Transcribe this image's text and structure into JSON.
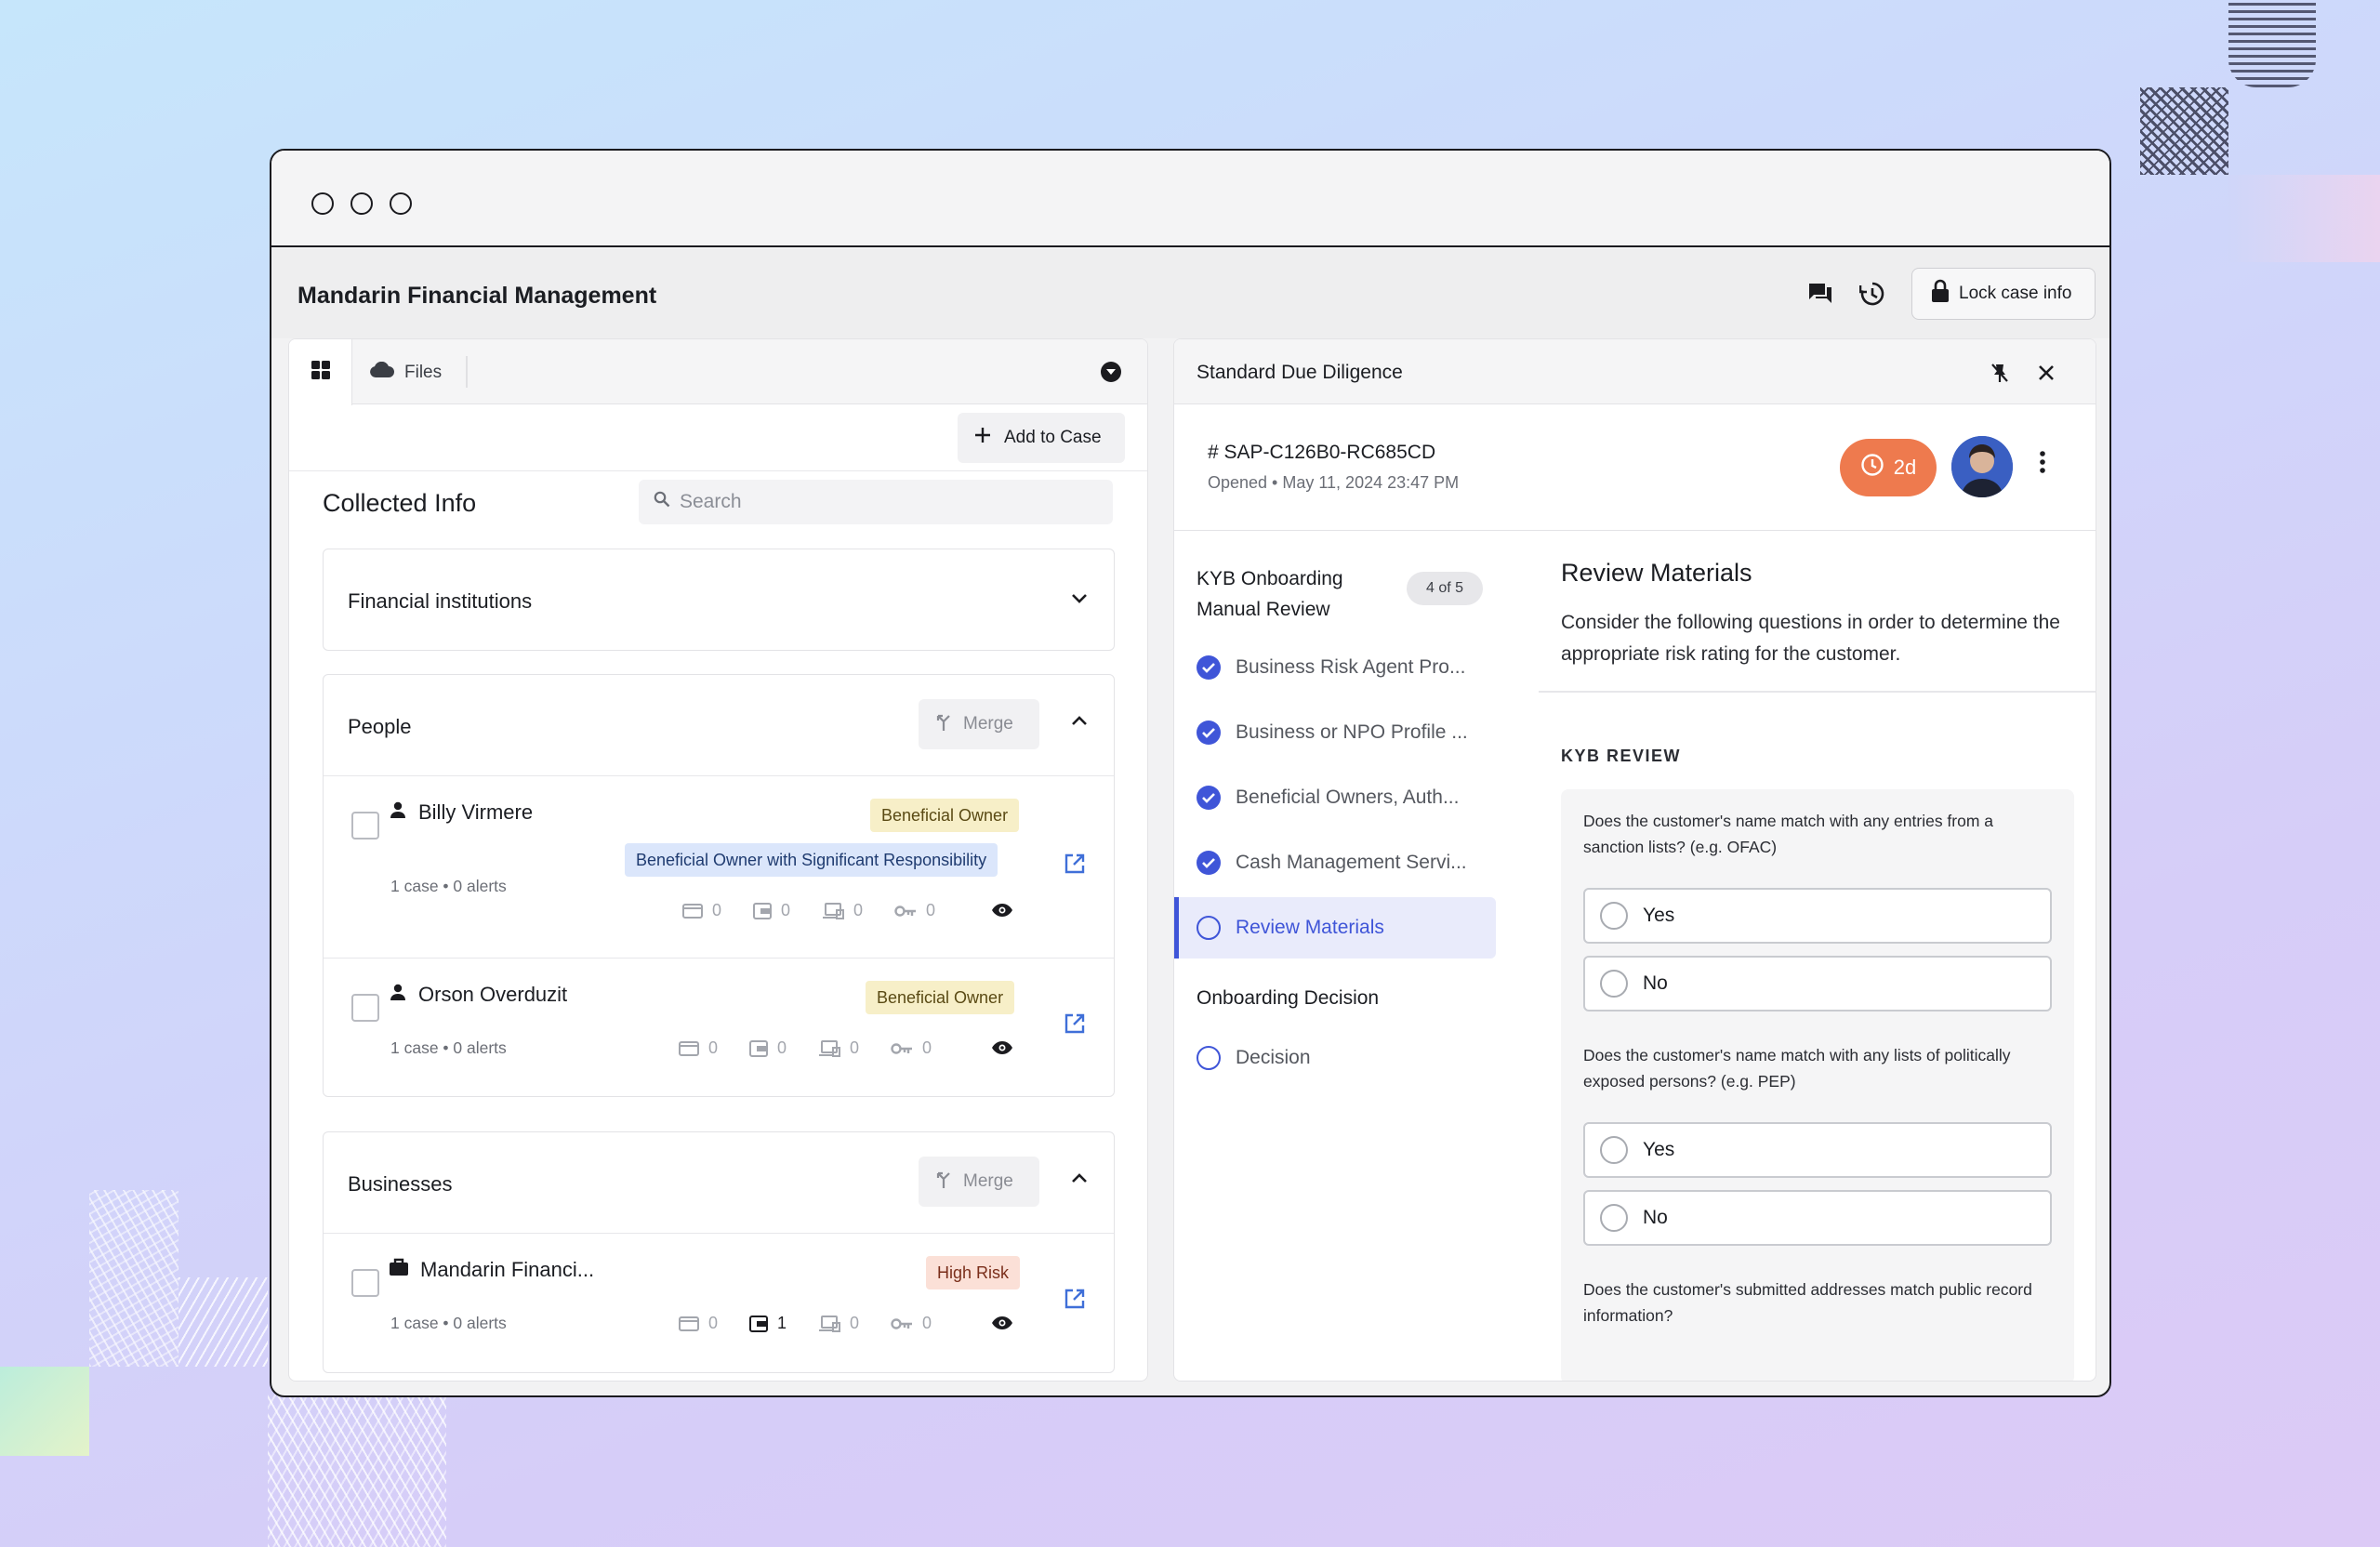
{
  "app": {
    "title": "Mandarin Financial Management",
    "lock_label": "Lock case info"
  },
  "left": {
    "tabs": {
      "files_label": "Files"
    },
    "add_to_case": "Add to Case",
    "collected_title": "Collected Info",
    "search_placeholder": "Search",
    "sections": {
      "financial": {
        "title": "Financial institutions"
      },
      "people": {
        "title": "People",
        "merge": "Merge",
        "rows": [
          {
            "name": "Billy Virmere",
            "meta": "1 case • 0 alerts",
            "badges": [
              "Beneficial Owner",
              "Beneficial Owner with Significant Responsibility"
            ],
            "stats": [
              "0",
              "0",
              "0",
              "0"
            ]
          },
          {
            "name": "Orson Overduzit",
            "meta": "1 case • 0 alerts",
            "badges": [
              "Beneficial Owner"
            ],
            "stats": [
              "0",
              "0",
              "0",
              "0"
            ]
          }
        ]
      },
      "businesses": {
        "title": "Businesses",
        "merge": "Merge",
        "rows": [
          {
            "name": "Mandarin Financi...",
            "meta": "1 case • 0 alerts",
            "badges": [
              "High Risk"
            ],
            "stats": [
              "0",
              "1",
              "0",
              "0"
            ]
          }
        ]
      }
    }
  },
  "right": {
    "header_title": "Standard Due Diligence",
    "case": {
      "id": "# SAP-C126B0-RC685CD",
      "opened": "Opened • May 11, 2024 23:47 PM",
      "timer": "2d"
    },
    "workflow": {
      "title_line1": "KYB Onboarding",
      "title_line2": "Manual Review",
      "count": "4 of 5",
      "steps": [
        {
          "label": "Business Risk Agent Pro...",
          "state": "done"
        },
        {
          "label": "Business or NPO Profile ...",
          "state": "done"
        },
        {
          "label": "Beneficial Owners, Auth...",
          "state": "done"
        },
        {
          "label": "Cash Management Servi...",
          "state": "done"
        },
        {
          "label": "Review Materials",
          "state": "active"
        }
      ],
      "decision_title": "Onboarding Decision",
      "decision_step": "Decision"
    },
    "review": {
      "title": "Review Materials",
      "description": "Consider the following questions in order to determine the appropriate risk rating for the customer.",
      "section_label": "KYB REVIEW",
      "questions": [
        {
          "text": "Does the customer's name match with any entries from a sanction lists? (e.g. OFAC)",
          "options": [
            "Yes",
            "No"
          ]
        },
        {
          "text": "Does the customer's name match with any lists of politically exposed persons? (e.g. PEP)",
          "options": [
            "Yes",
            "No"
          ]
        },
        {
          "text": "Does the customer's submitted addresses match public record information?",
          "options": []
        }
      ]
    }
  },
  "colors": {
    "accent": "#3f55d8",
    "timer": "#ee7a4e",
    "badge_owner": "#f7efc8",
    "badge_significant": "#dbe6fb",
    "badge_high_risk": "#fbe0d7"
  }
}
